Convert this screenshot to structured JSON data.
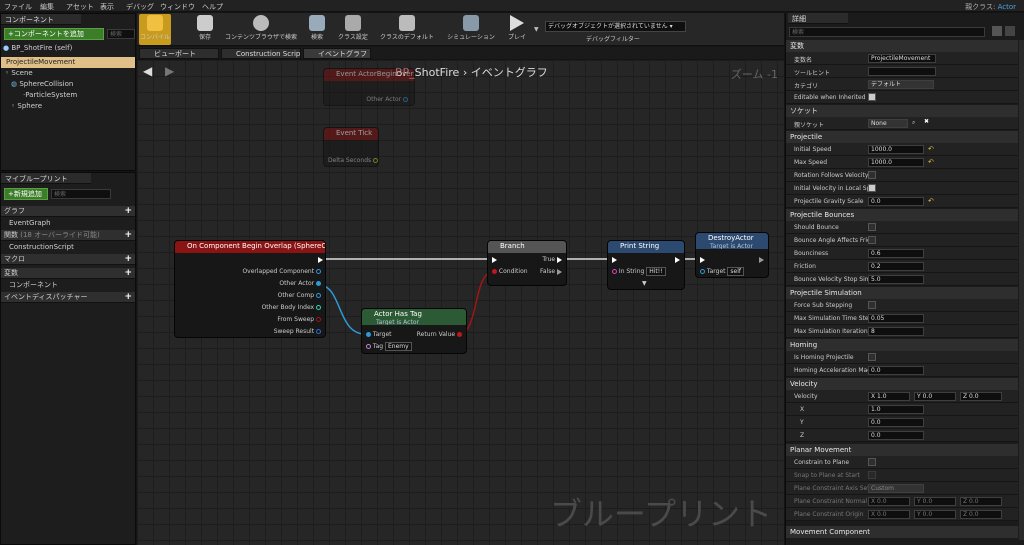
{
  "menu": [
    "ファイル",
    "編集",
    "アセット",
    "表示",
    "デバッグ",
    "ウィンドウ",
    "ヘルプ"
  ],
  "parent_class_label": "親クラス:",
  "parent_class_value": "Actor",
  "components_panel": {
    "tab": "コンポーネント",
    "add_button": "+コンポーネントを追加",
    "search_placeholder": "検索",
    "self_label": "BP_ShotFire (self)",
    "items": [
      "ProjectileMovement",
      "Scene",
      "SphereCollision",
      "ParticleSystem",
      "Sphere"
    ]
  },
  "my_blueprint": {
    "tab": "マイブループリント",
    "add_button": "+新規追加",
    "search_placeholder": "検索",
    "sections": {
      "graphs": "グラフ",
      "event_graph": "EventGraph",
      "functions": "関数",
      "functions_note": "(18 オーバーライド可能)",
      "construction_script": "ConstructionScript",
      "macros": "マクロ",
      "variables": "変数",
      "components": "コンポーネント",
      "dispatchers": "イベントディスパッチャー"
    }
  },
  "toolbar": {
    "compile": "コンパイル",
    "save": "保存",
    "browse": "コンテンツブラウザで検索",
    "find": "検索",
    "class_settings": "クラス設定",
    "class_defaults": "クラスのデフォルト",
    "simulation": "シミュレーション",
    "play": "プレイ",
    "debug_select": "デバッグオブジェクトが選択されていません",
    "debug_filter": "デバッグフィルター"
  },
  "doc_tabs": [
    "ビューポート",
    "Construction Scrip",
    "イベントグラフ"
  ],
  "graph": {
    "breadcrumb_bp": "BP_ShotFire",
    "breadcrumb_sep": "›",
    "breadcrumb_graph": "イベントグラフ",
    "zoom": "ズーム -1",
    "watermark": "ブループリント",
    "nodes": {
      "begin_overlap_top": {
        "title": "Event ActorBeginOverlap",
        "pin": "Other Actor"
      },
      "event_tick": {
        "title": "Event Tick",
        "pin": "Delta Seconds"
      },
      "on_comp_overlap": {
        "title": "On Component Begin Overlap (SphereCollision)",
        "pins": [
          "Overlapped Component",
          "Other Actor",
          "Other Comp",
          "Other Body Index",
          "From Sweep",
          "Sweep Result"
        ]
      },
      "actor_has_tag": {
        "title": "Actor Has Tag",
        "subtitle": "Target is Actor",
        "target": "Target",
        "tag": "Tag",
        "tag_value": "Enemy",
        "ret": "Return Value"
      },
      "branch": {
        "title": "Branch",
        "condition": "Condition",
        "true_pin": "True",
        "false_pin": "False"
      },
      "print_string": {
        "title": "Print String",
        "in_string": "In String",
        "value": "Hit!!"
      },
      "destroy_actor": {
        "title": "DestroyActor",
        "subtitle": "Target is Actor",
        "target": "Target",
        "value": "self"
      }
    }
  },
  "details": {
    "tab": "詳細",
    "search_placeholder": "検索",
    "sections": {
      "variable": {
        "title": "変数",
        "rows": {
          "name_k": "変数名",
          "name_v": "ProjectileMovement",
          "tooltip_k": "ツールヒント",
          "category_k": "カテゴリ",
          "category_v": "デフォルト",
          "editable_k": "Editable when Inherited"
        }
      },
      "socket": {
        "title": "ソケット",
        "parent_k": "親ソケット",
        "parent_v": "None"
      },
      "projectile": {
        "title": "Projectile",
        "initial_speed_k": "Initial Speed",
        "initial_speed_v": "1000.0",
        "max_speed_k": "Max Speed",
        "max_speed_v": "1000.0",
        "rot_k": "Rotation Follows Velocity",
        "local_k": "Initial Velocity in Local Sp",
        "grav_k": "Projectile Gravity Scale",
        "grav_v": "0.0"
      },
      "bounces": {
        "title": "Projectile Bounces",
        "should_k": "Should Bounce",
        "angle_k": "Bounce Angle Affects Frict",
        "bounciness_k": "Bounciness",
        "bounciness_v": "0.6",
        "friction_k": "Friction",
        "friction_v": "0.2",
        "stop_k": "Bounce Velocity Stop Simu",
        "stop_v": "5.0"
      },
      "simulation": {
        "title": "Projectile Simulation",
        "sub_k": "Force Sub Stepping",
        "step_k": "Max Simulation Time Step",
        "step_v": "0.05",
        "iter_k": "Max Simulation Iterations",
        "iter_v": "8"
      },
      "homing": {
        "title": "Homing",
        "proj_k": "Is Homing Projectile",
        "accel_k": "Homing Acceleration Magr",
        "accel_v": "0.0"
      },
      "velocity": {
        "title": "Velocity",
        "vel_k": "Velocity",
        "x_lbl": "X",
        "x_v": "1.0",
        "y_lbl": "Y",
        "y_v": "0.0",
        "z_lbl": "Z",
        "z_v": "0.0"
      },
      "planar": {
        "title": "Planar Movement",
        "constrain_k": "Constrain to Plane",
        "snap_k": "Snap to Plane at Start",
        "axis_k": "Plane Constraint Axis Setti",
        "axis_v": "Custom",
        "normal_k": "Plane Constraint Normal",
        "origin_k": "Plane Constraint Origin"
      },
      "movement_component": {
        "title": "Movement Component"
      }
    }
  }
}
